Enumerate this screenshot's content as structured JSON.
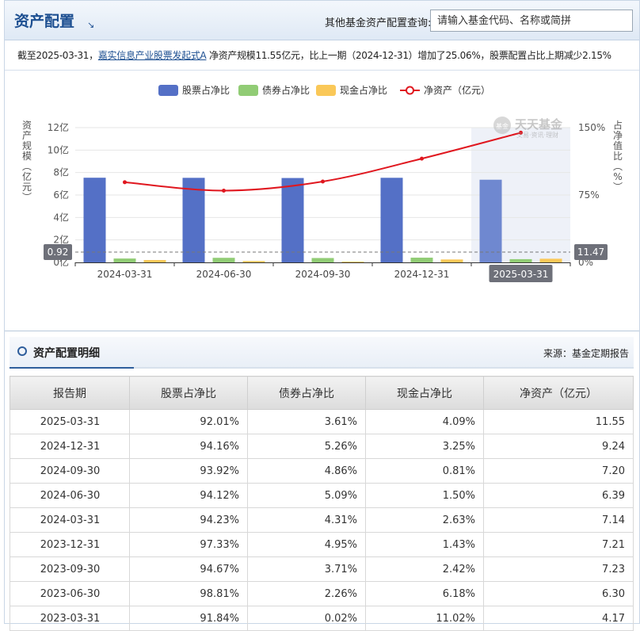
{
  "header": {
    "title": "资产配置",
    "query_label": "其他基金资产配置查询:",
    "search_placeholder": "请输入基金代码、名称或简拼"
  },
  "summary": {
    "prefix": "截至2025-03-31，",
    "fund_name": "嘉实信息产业股票发起式A",
    "suffix": " 净资产规模11.55亿元，比上一期（2024-12-31）增加了25.06%，股票配置占比上期减少2.15%"
  },
  "watermark": {
    "title": "天天基金",
    "subtitle": "交易·资讯·理财",
    "badge": "基金"
  },
  "chart_data": {
    "type": "bar",
    "categories": [
      "2024-03-31",
      "2024-06-30",
      "2024-09-30",
      "2024-12-31",
      "2025-03-31"
    ],
    "series": [
      {
        "name": "股票占净比",
        "kind": "bar",
        "axis": "right",
        "color": "#5470c6",
        "values": [
          94.23,
          94.12,
          93.92,
          94.16,
          92.01
        ]
      },
      {
        "name": "债券占净比",
        "kind": "bar",
        "axis": "right",
        "color": "#91cc75",
        "values": [
          4.31,
          5.09,
          4.86,
          5.26,
          3.61
        ]
      },
      {
        "name": "现金占净比",
        "kind": "bar",
        "axis": "right",
        "color": "#fac858",
        "values": [
          2.63,
          1.5,
          0.81,
          3.25,
          4.09
        ]
      },
      {
        "name": "净资产（亿元）",
        "kind": "line",
        "axis": "left",
        "color": "#e0171f",
        "values": [
          7.14,
          6.39,
          7.2,
          9.24,
          11.55
        ]
      }
    ],
    "left_axis": {
      "label": "资产规模（亿元）",
      "ticks": [
        "0亿",
        "2亿",
        "4亿",
        "6亿",
        "8亿",
        "10亿",
        "12亿"
      ],
      "range": [
        0,
        12
      ]
    },
    "right_axis": {
      "label": "占净值比（%）",
      "ticks": [
        "0%",
        "75%",
        "150%"
      ],
      "range": [
        0,
        150
      ]
    },
    "highlighted_category": "2025-03-31",
    "crosshair": {
      "left_value": "0.92",
      "right_value": "11.47"
    },
    "legend_position": "top-center",
    "grid": true
  },
  "detail": {
    "title": "资产配置明细",
    "source": "来源：基金定期报告",
    "columns": [
      "报告期",
      "股票占净比",
      "债券占净比",
      "现金占净比",
      "净资产（亿元）"
    ],
    "rows": [
      [
        "2025-03-31",
        "92.01%",
        "3.61%",
        "4.09%",
        "11.55"
      ],
      [
        "2024-12-31",
        "94.16%",
        "5.26%",
        "3.25%",
        "9.24"
      ],
      [
        "2024-09-30",
        "93.92%",
        "4.86%",
        "0.81%",
        "7.20"
      ],
      [
        "2024-06-30",
        "94.12%",
        "5.09%",
        "1.50%",
        "6.39"
      ],
      [
        "2024-03-31",
        "94.23%",
        "4.31%",
        "2.63%",
        "7.14"
      ],
      [
        "2023-12-31",
        "97.33%",
        "4.95%",
        "1.43%",
        "7.21"
      ],
      [
        "2023-09-30",
        "94.67%",
        "3.71%",
        "2.42%",
        "7.23"
      ],
      [
        "2023-06-30",
        "98.81%",
        "2.26%",
        "6.18%",
        "6.30"
      ],
      [
        "2023-03-31",
        "91.84%",
        "0.02%",
        "11.02%",
        "4.17"
      ]
    ]
  }
}
